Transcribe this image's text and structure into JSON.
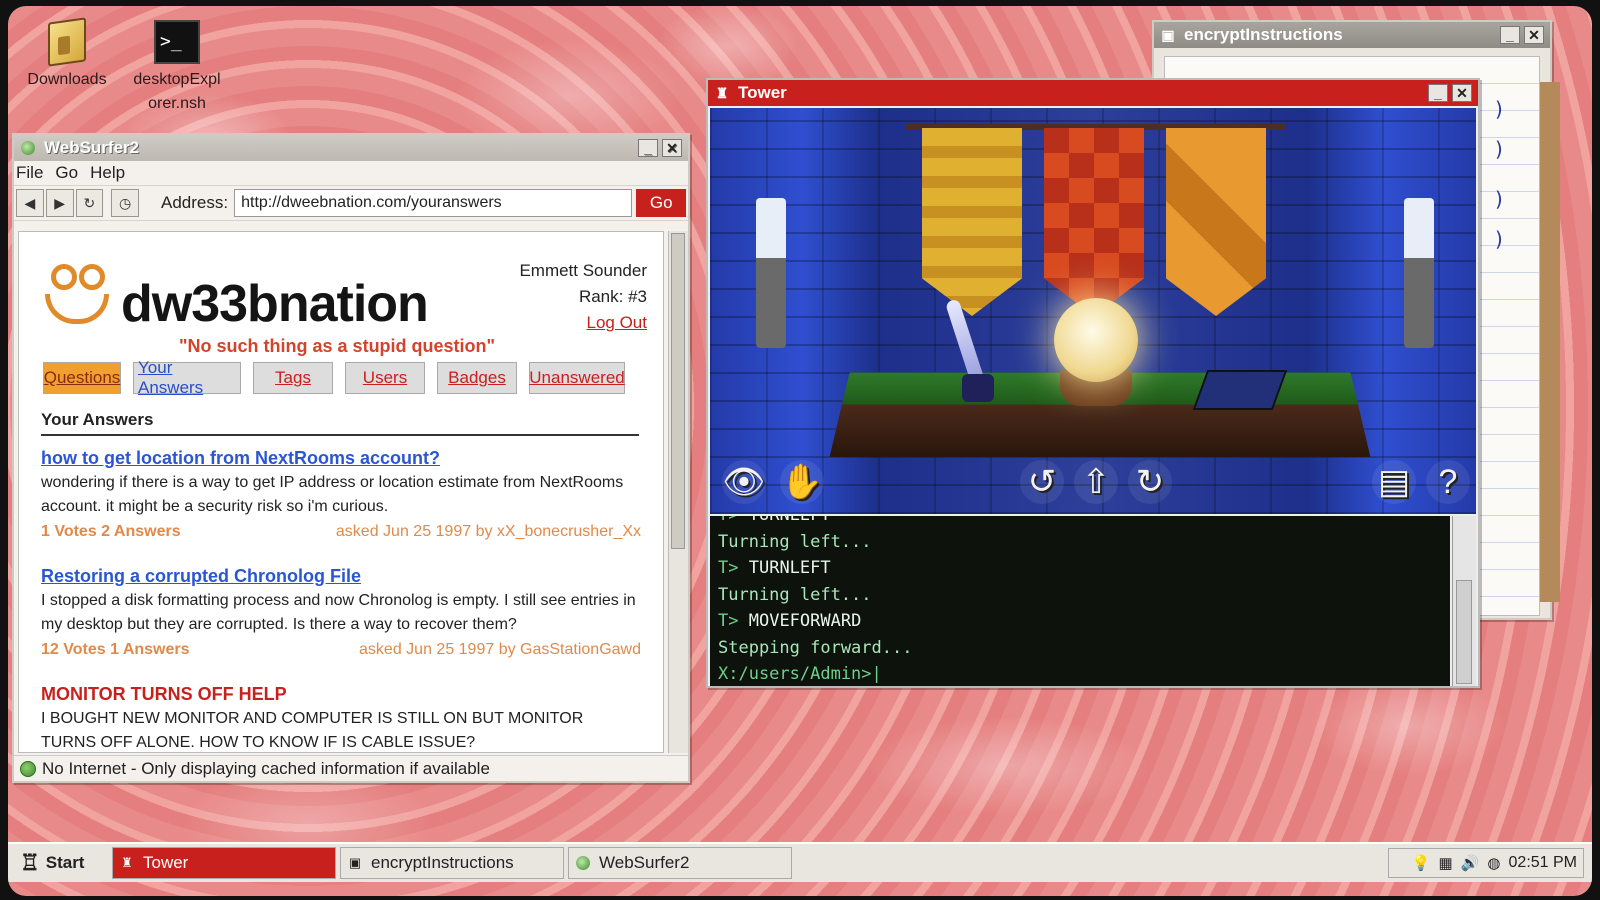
{
  "desktop": {
    "icons": [
      {
        "label": "Downloads",
        "icon": "folder-icon"
      },
      {
        "label_line1": "desktopExpl",
        "label_line2": "orer.nsh",
        "icon": "terminal-icon"
      }
    ]
  },
  "websurfer": {
    "title": "WebSurfer2",
    "menu": [
      "File",
      "Go",
      "Help"
    ],
    "address_label": "Address:",
    "address_value": "http://dweebnation.com/youranswers",
    "go_label": "Go",
    "status": "No Internet - Only displaying cached information if available",
    "site": {
      "logo_text_a": "dw33b",
      "logo_text_b": "nation",
      "tagline": "\"No such thing as a stupid question\"",
      "user_name": "Emmett Sounder",
      "rank": "Rank: #3",
      "logout": "Log Out",
      "tabs": [
        "Questions",
        "Your Answers",
        "Tags",
        "Users",
        "Badges",
        "Unanswered"
      ],
      "section_heading": "Your Answers",
      "questions": [
        {
          "title": "how to get location from NextRooms account?",
          "body": "wondering if there is a way to get IP address or location estimate from NextRooms account. it might be a security risk so i'm curious.",
          "votes": "1 Votes 2 Answers",
          "asked": "asked Jun 25 1997 by xX_bonecrusher_Xx"
        },
        {
          "title": "Restoring a corrupted Chronolog File",
          "body": "I stopped a disk formatting process and now Chronolog is empty. I still see entries in my desktop but they are corrupted. Is there a way to recover them?",
          "votes": "12 Votes 1 Answers",
          "asked": "asked Jun 25 1997 by GasStationGawd"
        },
        {
          "title": "MONITOR TURNS OFF HELP",
          "body": "I BOUGHT NEW MONITOR AND COMPUTER IS STILL ON BUT MONITOR TURNS OFF ALONE. HOW TO KNOW IF IS CABLE ISSUE?"
        }
      ]
    }
  },
  "encrypt": {
    "title": "encryptInstructions"
  },
  "tower": {
    "title": "Tower",
    "controls": [
      "eye-icon",
      "hand-icon",
      "turn-left-icon",
      "move-forward-icon",
      "turn-right-icon",
      "notes-icon",
      "help-icon"
    ],
    "console": {
      "lines": [
        {
          "type": "cmd",
          "prefix": "T>",
          "text": "TURNLEFT"
        },
        {
          "type": "out",
          "text": "Turning left..."
        },
        {
          "type": "cmd",
          "prefix": "T>",
          "text": "TURNLEFT"
        },
        {
          "type": "out",
          "text": "Turning left..."
        },
        {
          "type": "cmd",
          "prefix": "T>",
          "text": "MOVEFORWARD"
        },
        {
          "type": "out",
          "text": "Stepping forward..."
        }
      ],
      "prompt": "X:/users/Admin>|"
    }
  },
  "taskbar": {
    "start": "Start",
    "items": [
      "Tower",
      "encryptInstructions",
      "WebSurfer2"
    ],
    "clock": "02:51 PM"
  }
}
